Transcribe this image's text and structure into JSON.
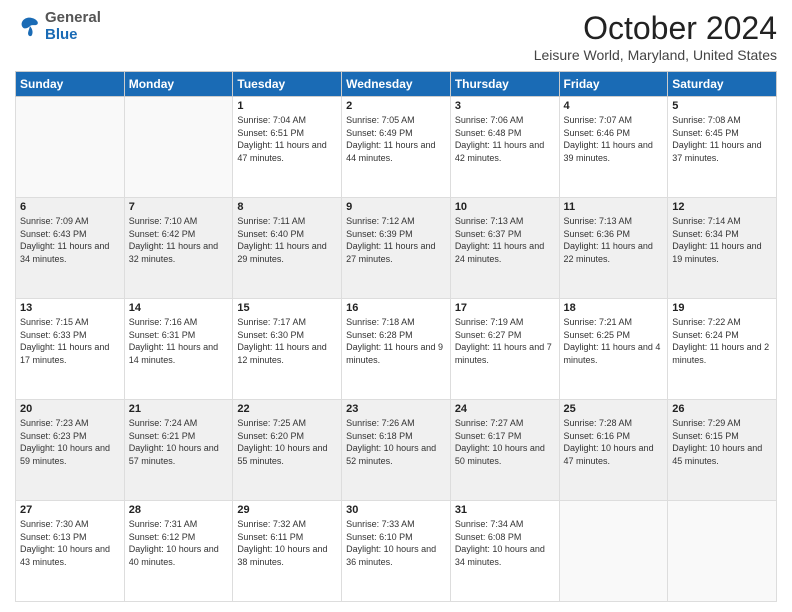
{
  "header": {
    "logo_general": "General",
    "logo_blue": "Blue",
    "month": "October 2024",
    "location": "Leisure World, Maryland, United States"
  },
  "days_of_week": [
    "Sunday",
    "Monday",
    "Tuesday",
    "Wednesday",
    "Thursday",
    "Friday",
    "Saturday"
  ],
  "weeks": [
    [
      {
        "day": "",
        "info": ""
      },
      {
        "day": "",
        "info": ""
      },
      {
        "day": "1",
        "info": "Sunrise: 7:04 AM\nSunset: 6:51 PM\nDaylight: 11 hours and 47 minutes."
      },
      {
        "day": "2",
        "info": "Sunrise: 7:05 AM\nSunset: 6:49 PM\nDaylight: 11 hours and 44 minutes."
      },
      {
        "day": "3",
        "info": "Sunrise: 7:06 AM\nSunset: 6:48 PM\nDaylight: 11 hours and 42 minutes."
      },
      {
        "day": "4",
        "info": "Sunrise: 7:07 AM\nSunset: 6:46 PM\nDaylight: 11 hours and 39 minutes."
      },
      {
        "day": "5",
        "info": "Sunrise: 7:08 AM\nSunset: 6:45 PM\nDaylight: 11 hours and 37 minutes."
      }
    ],
    [
      {
        "day": "6",
        "info": "Sunrise: 7:09 AM\nSunset: 6:43 PM\nDaylight: 11 hours and 34 minutes."
      },
      {
        "day": "7",
        "info": "Sunrise: 7:10 AM\nSunset: 6:42 PM\nDaylight: 11 hours and 32 minutes."
      },
      {
        "day": "8",
        "info": "Sunrise: 7:11 AM\nSunset: 6:40 PM\nDaylight: 11 hours and 29 minutes."
      },
      {
        "day": "9",
        "info": "Sunrise: 7:12 AM\nSunset: 6:39 PM\nDaylight: 11 hours and 27 minutes."
      },
      {
        "day": "10",
        "info": "Sunrise: 7:13 AM\nSunset: 6:37 PM\nDaylight: 11 hours and 24 minutes."
      },
      {
        "day": "11",
        "info": "Sunrise: 7:13 AM\nSunset: 6:36 PM\nDaylight: 11 hours and 22 minutes."
      },
      {
        "day": "12",
        "info": "Sunrise: 7:14 AM\nSunset: 6:34 PM\nDaylight: 11 hours and 19 minutes."
      }
    ],
    [
      {
        "day": "13",
        "info": "Sunrise: 7:15 AM\nSunset: 6:33 PM\nDaylight: 11 hours and 17 minutes."
      },
      {
        "day": "14",
        "info": "Sunrise: 7:16 AM\nSunset: 6:31 PM\nDaylight: 11 hours and 14 minutes."
      },
      {
        "day": "15",
        "info": "Sunrise: 7:17 AM\nSunset: 6:30 PM\nDaylight: 11 hours and 12 minutes."
      },
      {
        "day": "16",
        "info": "Sunrise: 7:18 AM\nSunset: 6:28 PM\nDaylight: 11 hours and 9 minutes."
      },
      {
        "day": "17",
        "info": "Sunrise: 7:19 AM\nSunset: 6:27 PM\nDaylight: 11 hours and 7 minutes."
      },
      {
        "day": "18",
        "info": "Sunrise: 7:21 AM\nSunset: 6:25 PM\nDaylight: 11 hours and 4 minutes."
      },
      {
        "day": "19",
        "info": "Sunrise: 7:22 AM\nSunset: 6:24 PM\nDaylight: 11 hours and 2 minutes."
      }
    ],
    [
      {
        "day": "20",
        "info": "Sunrise: 7:23 AM\nSunset: 6:23 PM\nDaylight: 10 hours and 59 minutes."
      },
      {
        "day": "21",
        "info": "Sunrise: 7:24 AM\nSunset: 6:21 PM\nDaylight: 10 hours and 57 minutes."
      },
      {
        "day": "22",
        "info": "Sunrise: 7:25 AM\nSunset: 6:20 PM\nDaylight: 10 hours and 55 minutes."
      },
      {
        "day": "23",
        "info": "Sunrise: 7:26 AM\nSunset: 6:18 PM\nDaylight: 10 hours and 52 minutes."
      },
      {
        "day": "24",
        "info": "Sunrise: 7:27 AM\nSunset: 6:17 PM\nDaylight: 10 hours and 50 minutes."
      },
      {
        "day": "25",
        "info": "Sunrise: 7:28 AM\nSunset: 6:16 PM\nDaylight: 10 hours and 47 minutes."
      },
      {
        "day": "26",
        "info": "Sunrise: 7:29 AM\nSunset: 6:15 PM\nDaylight: 10 hours and 45 minutes."
      }
    ],
    [
      {
        "day": "27",
        "info": "Sunrise: 7:30 AM\nSunset: 6:13 PM\nDaylight: 10 hours and 43 minutes."
      },
      {
        "day": "28",
        "info": "Sunrise: 7:31 AM\nSunset: 6:12 PM\nDaylight: 10 hours and 40 minutes."
      },
      {
        "day": "29",
        "info": "Sunrise: 7:32 AM\nSunset: 6:11 PM\nDaylight: 10 hours and 38 minutes."
      },
      {
        "day": "30",
        "info": "Sunrise: 7:33 AM\nSunset: 6:10 PM\nDaylight: 10 hours and 36 minutes."
      },
      {
        "day": "31",
        "info": "Sunrise: 7:34 AM\nSunset: 6:08 PM\nDaylight: 10 hours and 34 minutes."
      },
      {
        "day": "",
        "info": ""
      },
      {
        "day": "",
        "info": ""
      }
    ]
  ]
}
